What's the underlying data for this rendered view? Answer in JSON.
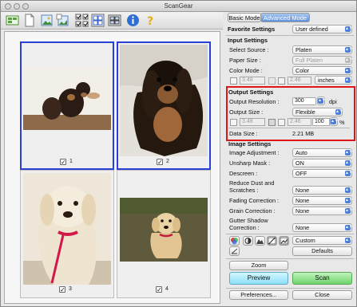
{
  "window": {
    "title": "ScanGear"
  },
  "tabs": {
    "basic": "Basic Mode",
    "advanced": "Advanced Mode"
  },
  "favorite": {
    "label": "Favorite Settings",
    "value": "User defined"
  },
  "input": {
    "heading": "Input Settings",
    "select_source": {
      "label": "Select Source :",
      "value": "Platen"
    },
    "paper_size": {
      "label": "Paper Size :",
      "value": "Full Platen"
    },
    "color_mode": {
      "label": "Color Mode :",
      "value": "Color"
    },
    "width": "3.48",
    "height": "2.46",
    "unit": "inches"
  },
  "output": {
    "heading": "Output Settings",
    "resolution": {
      "label": "Output Resolution :",
      "value": "300",
      "unit": "dpi"
    },
    "size": {
      "label": "Output Size :",
      "value": "Flexible"
    },
    "width": "3.48",
    "height": "2.46",
    "scale": "100",
    "scale_unit": "%",
    "data_size": {
      "label": "Data Size :",
      "value": "2.21 MB"
    }
  },
  "image": {
    "heading": "Image Settings",
    "adjustment": {
      "label": "Image Adjustment :",
      "value": "Auto"
    },
    "unsharp": {
      "label": "Unsharp Mask :",
      "value": "ON"
    },
    "descreen": {
      "label": "Descreen :",
      "value": "OFF"
    },
    "dust_l1": "Reduce Dust and",
    "dust_l2": "Scratches :",
    "dust_value": "None",
    "fading": {
      "label": "Fading Correction :",
      "value": "None"
    },
    "grain": {
      "label": "Grain Correction :",
      "value": "None"
    },
    "gutter_l1": "Gutter Shadow",
    "gutter_l2": "Correction :",
    "gutter_value": "None"
  },
  "tools": {
    "preset": "Custom",
    "defaults": "Defaults"
  },
  "buttons": {
    "zoom": "Zoom",
    "preview": "Preview",
    "scan": "Scan",
    "preferences": "Preferences...",
    "close": "Close"
  },
  "thumbs": [
    {
      "num": "1",
      "checked": true,
      "selected": true
    },
    {
      "num": "2",
      "checked": true,
      "selected": true
    },
    {
      "num": "3",
      "checked": true,
      "selected": false
    },
    {
      "num": "4",
      "checked": true,
      "selected": false
    }
  ],
  "colors": {
    "selection": "#2a3fd3",
    "highlight": "#e01515",
    "preview_btn": "#9fe7ff",
    "scan_btn": "#7fe27f"
  }
}
